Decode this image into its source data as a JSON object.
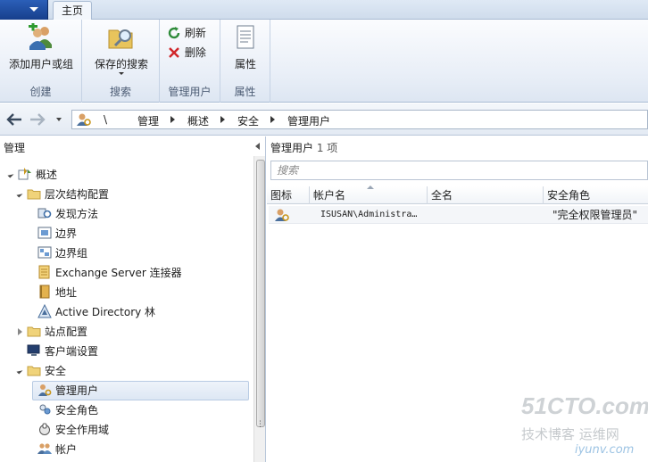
{
  "ribbon": {
    "tab_home": "主页",
    "groups": {
      "create": {
        "label": "创建",
        "add_button": "添加用户或组"
      },
      "search": {
        "label": "搜索",
        "saved_search_button": "保存的搜索"
      },
      "manage": {
        "label": "管理用户",
        "refresh_button": "刷新",
        "delete_button": "删除"
      },
      "props": {
        "label": "属性",
        "properties_button": "属性"
      }
    }
  },
  "address": {
    "breadcrumb": [
      "\\",
      "管理",
      "概述",
      "安全",
      "管理用户"
    ]
  },
  "left_pane": {
    "title": "管理",
    "tree": [
      {
        "label": "概述",
        "icon": "overview-icon",
        "level": 0,
        "expander": "open"
      },
      {
        "label": "层次结构配置",
        "icon": "folder-icon",
        "level": 1,
        "expander": "open"
      },
      {
        "label": "发现方法",
        "icon": "discovery-icon",
        "level": 2,
        "expander": ""
      },
      {
        "label": "边界",
        "icon": "boundary-icon",
        "level": 2,
        "expander": ""
      },
      {
        "label": "边界组",
        "icon": "boundary-group-icon",
        "level": 2,
        "expander": ""
      },
      {
        "label": "Exchange Server 连接器",
        "icon": "exchange-connector-icon",
        "level": 2,
        "expander": ""
      },
      {
        "label": "地址",
        "icon": "address-icon",
        "level": 2,
        "expander": ""
      },
      {
        "label": "Active Directory 林",
        "icon": "ad-forest-icon",
        "level": 2,
        "expander": ""
      },
      {
        "label": "站点配置",
        "icon": "folder-icon",
        "level": 1,
        "expander": "closed"
      },
      {
        "label": "客户端设置",
        "icon": "client-settings-icon",
        "level": 1,
        "expander": ""
      },
      {
        "label": "安全",
        "icon": "folder-icon",
        "level": 1,
        "expander": "open"
      },
      {
        "label": "管理用户",
        "icon": "admin-users-icon",
        "level": 2,
        "expander": "",
        "selected": true
      },
      {
        "label": "安全角色",
        "icon": "security-roles-icon",
        "level": 2,
        "expander": ""
      },
      {
        "label": "安全作用域",
        "icon": "security-scopes-icon",
        "level": 2,
        "expander": ""
      },
      {
        "label": "帐户",
        "icon": "accounts-icon",
        "level": 2,
        "expander": ""
      }
    ]
  },
  "right_pane": {
    "title": "管理用户",
    "count": "1 项",
    "search_placeholder": "搜索",
    "columns": [
      "图标",
      "帐户名",
      "全名",
      "安全角色"
    ],
    "rows": [
      {
        "icon": "admin-user-icon",
        "account": "ISUSAN\\Administra…",
        "fullname": "",
        "role": "\"完全权限管理员\""
      }
    ]
  },
  "watermark": {
    "logo": "51CTO.com",
    "subtitle": "技术博客 运维网",
    "site": "iyunv.com"
  }
}
